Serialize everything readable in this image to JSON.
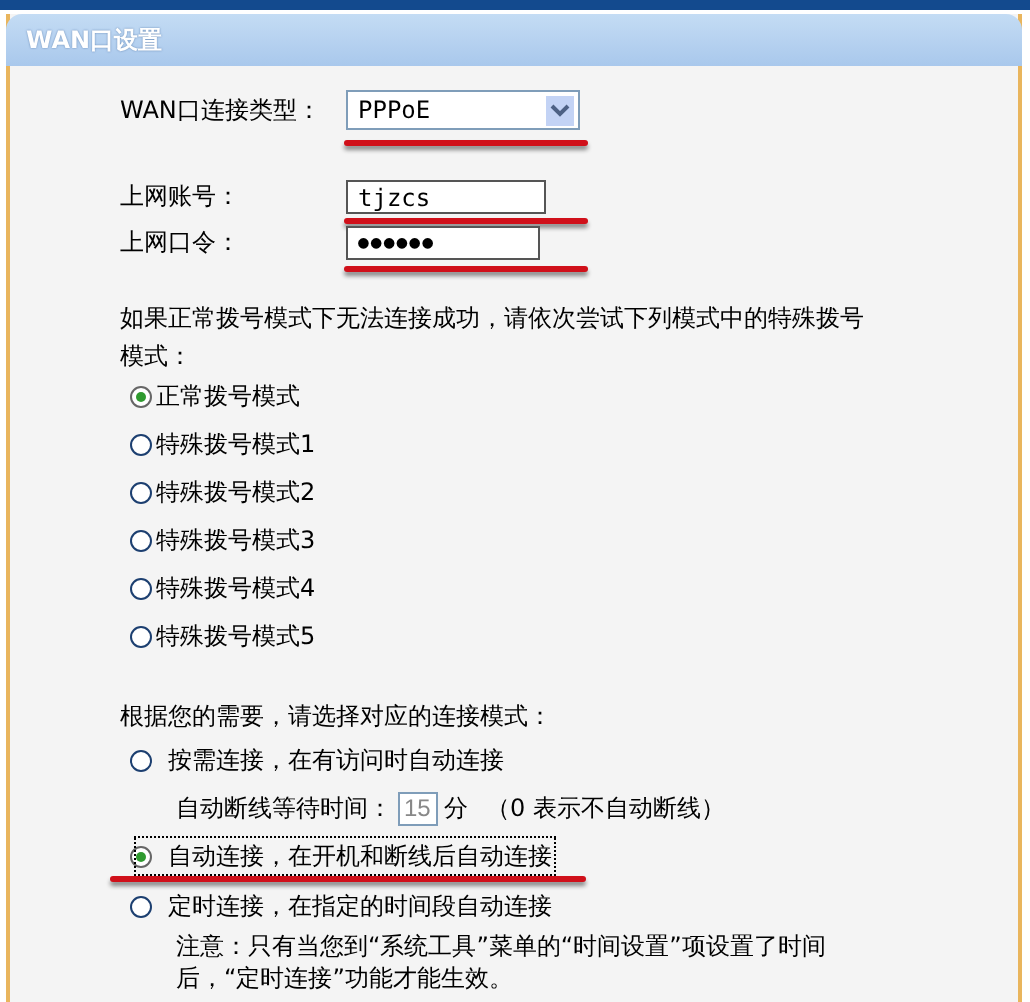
{
  "panel": {
    "title": "WAN口设置"
  },
  "connection_type": {
    "label": "WAN口连接类型：",
    "value": "PPPoE"
  },
  "account": {
    "label": "上网账号：",
    "value": "tjzcs"
  },
  "password": {
    "label": "上网口令：",
    "value": "●●●●●●"
  },
  "dial_hint": "如果正常拨号模式下无法连接成功，请依次尝试下列模式中的特殊拨号模式：",
  "dial_modes": [
    {
      "label": "正常拨号模式",
      "selected": true
    },
    {
      "label": "特殊拨号模式1",
      "selected": false
    },
    {
      "label": "特殊拨号模式2",
      "selected": false
    },
    {
      "label": "特殊拨号模式3",
      "selected": false
    },
    {
      "label": "特殊拨号模式4",
      "selected": false
    },
    {
      "label": "特殊拨号模式5",
      "selected": false
    }
  ],
  "connect_hint": "根据您的需要，请选择对应的连接模式：",
  "connect_modes": [
    {
      "label": "按需连接，在有访问时自动连接",
      "selected": false,
      "idle": {
        "label": "自动断线等待时间：",
        "value": "15",
        "unit": "分",
        "note": "（0 表示不自动断线）"
      }
    },
    {
      "label": "自动连接，在开机和断线后自动连接",
      "selected": true
    },
    {
      "label": "定时连接，在指定的时间段自动连接",
      "selected": false,
      "note": "注意：只有当您到“系统工具”菜单的“时间设置”项设置了时间后，“定时连接”功能才能生效。"
    }
  ]
}
